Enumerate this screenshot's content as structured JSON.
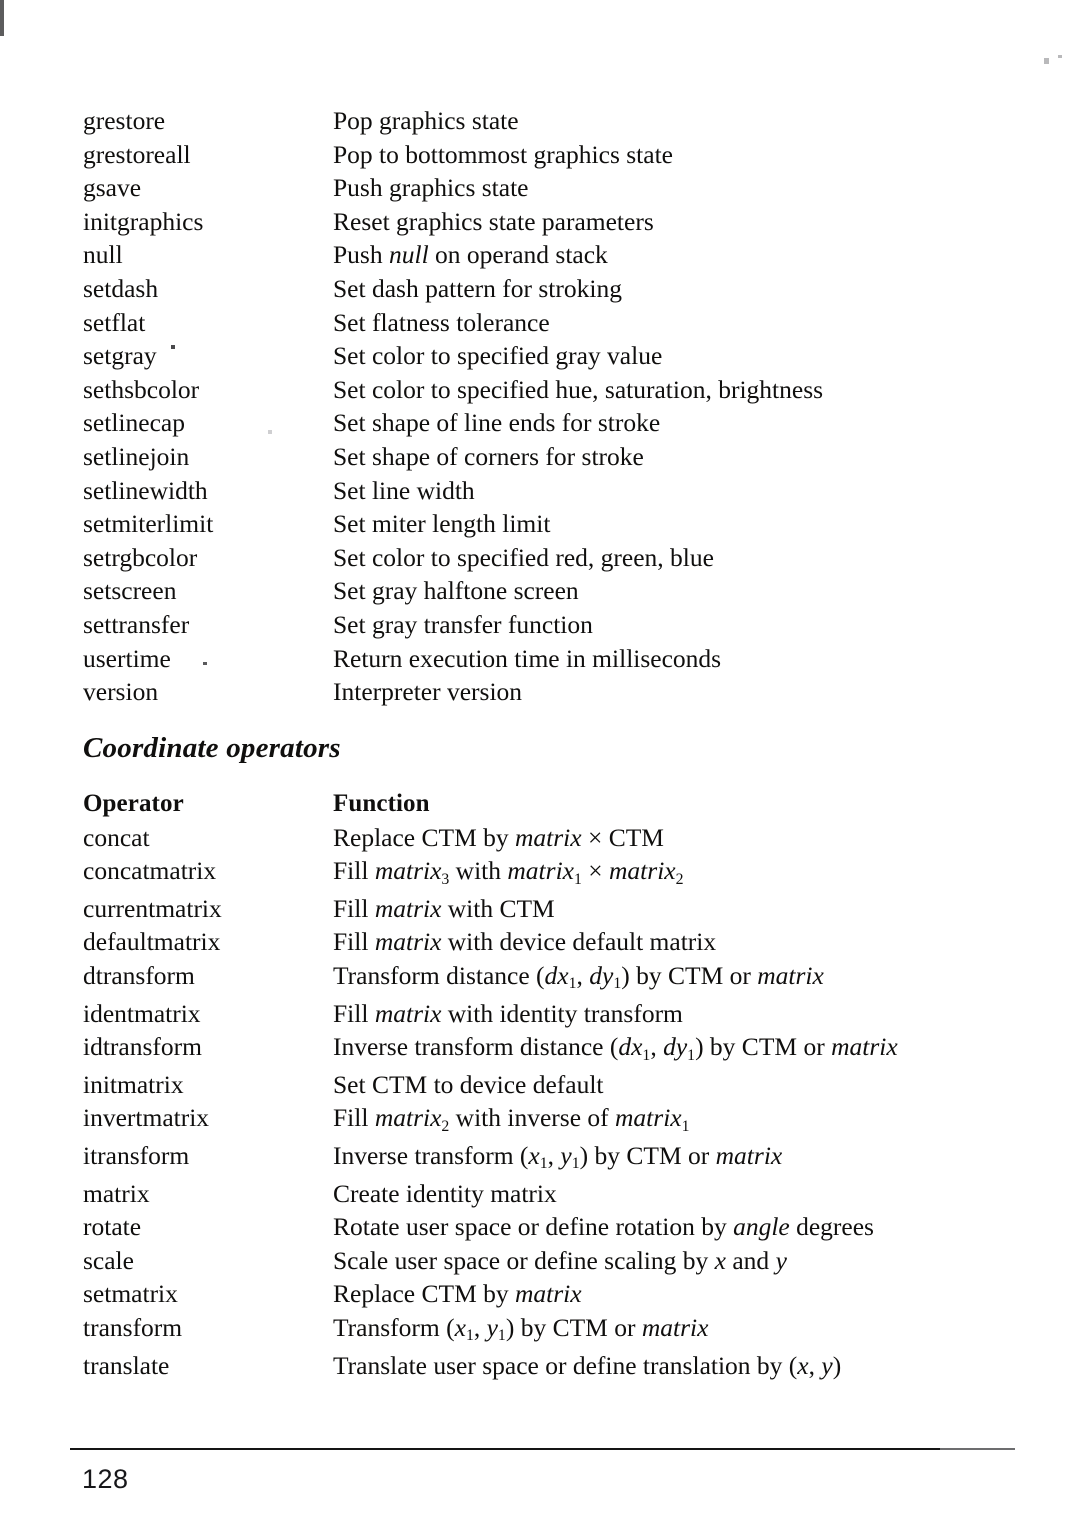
{
  "page": {
    "folio": "128",
    "edge_artifact": true
  },
  "graphics_state_block": {
    "rows": [
      {
        "operator": "grestore",
        "function": "Pop graphics state"
      },
      {
        "operator": "grestoreall",
        "function": "Pop to bottommost graphics state"
      },
      {
        "operator": "gsave",
        "function": "Push graphics state"
      },
      {
        "operator": "initgraphics",
        "function": "Reset graphics state parameters"
      },
      {
        "operator": "null",
        "function": "Push null on operand stack"
      },
      {
        "operator": "setdash",
        "function": "Set dash pattern for stroking"
      },
      {
        "operator": "setflat",
        "function": "Set flatness tolerance"
      },
      {
        "operator": "setgray",
        "function": "Set color to specified gray value"
      },
      {
        "operator": "sethsbcolor",
        "function": "Set color to specified hue, saturation, brightness"
      },
      {
        "operator": "setlinecap",
        "function": "Set shape of line ends for stroke"
      },
      {
        "operator": "setlinejoin",
        "function": "Set shape of corners for stroke"
      },
      {
        "operator": "setlinewidth",
        "function": "Set line width"
      },
      {
        "operator": "setmiterlimit",
        "function": "Set miter length limit"
      },
      {
        "operator": "setrgbcolor",
        "function": "Set color to specified red, green, blue"
      },
      {
        "operator": "setscreen",
        "function": "Set gray halftone screen"
      },
      {
        "operator": "settransfer",
        "function": "Set gray transfer function"
      },
      {
        "operator": "usertime",
        "function": "Return execution time in milliseconds"
      },
      {
        "operator": "version",
        "function": "Interpreter version"
      }
    ]
  },
  "coordinate_section": {
    "title": "Coordinate operators",
    "headers": {
      "operator": "Operator",
      "function": "Function"
    },
    "rows": [
      {
        "operator": "concat",
        "function": "Replace CTM by matrix × CTM"
      },
      {
        "operator": "concatmatrix",
        "function": "Fill matrix3 with matrix1 × matrix2"
      },
      {
        "operator": "currentmatrix",
        "function": "Fill matrix with CTM"
      },
      {
        "operator": "defaultmatrix",
        "function": "Fill matrix with device default matrix"
      },
      {
        "operator": "dtransform",
        "function": "Transform distance (dx1, dy1) by CTM or matrix"
      },
      {
        "operator": "identmatrix",
        "function": "Fill matrix with identity transform"
      },
      {
        "operator": "idtransform",
        "function": "Inverse transform distance (dx1, dy1) by CTM or matrix"
      },
      {
        "operator": "initmatrix",
        "function": "Set CTM to device default"
      },
      {
        "operator": "invertmatrix",
        "function": "Fill matrix2 with inverse of matrix1"
      },
      {
        "operator": "itransform",
        "function": "Inverse transform (x1, y1) by CTM or matrix"
      },
      {
        "operator": "matrix",
        "function": "Create identity matrix"
      },
      {
        "operator": "rotate",
        "function": "Rotate user space or define rotation by angle degrees"
      },
      {
        "operator": "scale",
        "function": "Scale user space or define scaling by x and y"
      },
      {
        "operator": "setmatrix",
        "function": "Replace CTM by matrix"
      },
      {
        "operator": "transform",
        "function": "Transform (x1, y1) by CTM or matrix"
      },
      {
        "operator": "translate",
        "function": "Translate user space or define translation by (x, y)"
      }
    ]
  }
}
